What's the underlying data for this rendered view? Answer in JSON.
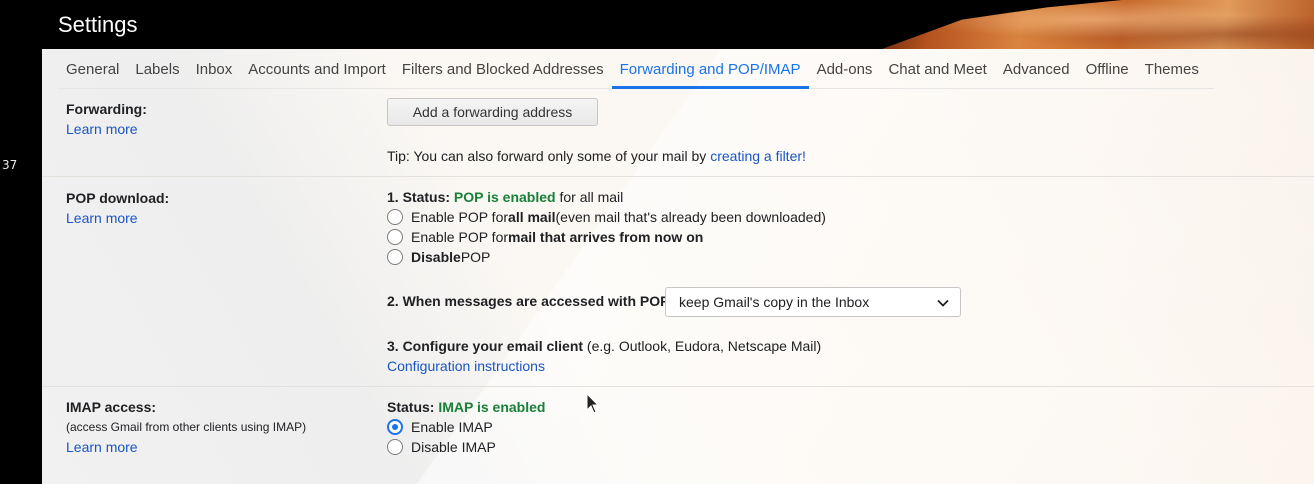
{
  "window": {
    "side_number": "37",
    "title": "Settings"
  },
  "tabs": [
    {
      "label": "General"
    },
    {
      "label": "Labels"
    },
    {
      "label": "Inbox"
    },
    {
      "label": "Accounts and Import"
    },
    {
      "label": "Filters and Blocked Addresses"
    },
    {
      "label": "Forwarding and POP/IMAP",
      "active": true
    },
    {
      "label": "Add-ons"
    },
    {
      "label": "Chat and Meet"
    },
    {
      "label": "Advanced"
    },
    {
      "label": "Offline"
    },
    {
      "label": "Themes"
    }
  ],
  "forwarding": {
    "label": "Forwarding:",
    "learn_more": "Learn more",
    "button": "Add a forwarding address",
    "tip_text": "Tip: You can also forward only some of your mail by ",
    "tip_link": "creating a filter!"
  },
  "pop": {
    "label": "POP download:",
    "learn_more": "Learn more",
    "status_prefix": "1. Status: ",
    "status_value": "POP is enabled",
    "status_suffix": " for all mail",
    "options": [
      {
        "pre": "Enable POP for ",
        "bold": "all mail",
        "post": " (even mail that's already been downloaded)",
        "selected": false
      },
      {
        "pre": "Enable POP for ",
        "bold": "mail that arrives from now on",
        "post": "",
        "selected": false
      },
      {
        "pre": "",
        "bold": "Disable",
        "post": " POP",
        "selected": false
      }
    ],
    "access_label": "2. When messages are accessed with POP",
    "access_selected": "keep Gmail's copy in the Inbox",
    "configure_label": "3. Configure your email client",
    "configure_hint": " (e.g. Outlook, Eudora, Netscape Mail)",
    "config_link": "Configuration instructions"
  },
  "imap": {
    "label": "IMAP access:",
    "sublabel": "(access Gmail from other clients using IMAP)",
    "learn_more": "Learn more",
    "status_prefix": "Status: ",
    "status_value": "IMAP is enabled",
    "options": [
      {
        "label": "Enable IMAP",
        "selected": true
      },
      {
        "label": "Disable IMAP",
        "selected": false
      }
    ]
  },
  "colors": {
    "accent": "#1a73e8",
    "link": "#1a55c4",
    "enabled_green": "#188038"
  }
}
